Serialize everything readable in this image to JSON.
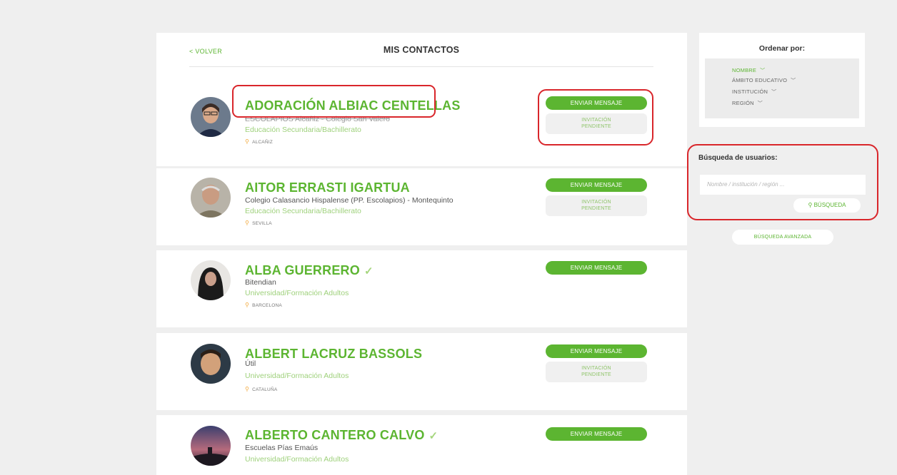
{
  "header": {
    "back_label": "< VOLVER",
    "title": "MIS CONTACTOS"
  },
  "contacts": [
    {
      "name": "ADORACIÓN ALBIAC CENTELLAS",
      "institution": "ESCOLAPIOS Alcañiz - Colegio San Valero",
      "level": "Educación Secundaria/Bachillerato",
      "location": "ALCAÑIZ",
      "message_label": "ENVIAR MENSAJE",
      "pending_label_1": "INVITACIÓN",
      "pending_label_2": "PENDIENTE"
    },
    {
      "name": "AITOR ERRASTI IGARTUA",
      "institution": "Colegio Calasancio Hispalense (PP. Escolapios) - Montequinto",
      "level": "Educación Secundaria/Bachillerato",
      "location": "SEVILLA",
      "message_label": "ENVIAR MENSAJE",
      "pending_label_1": "INVITACIÓN",
      "pending_label_2": "PENDIENTE"
    },
    {
      "name": "ALBA GUERRERO",
      "check": "✓",
      "institution": "Bitendian",
      "level": "Universidad/Formación Adultos",
      "location": "BARCELONA",
      "message_label": "ENVIAR MENSAJE"
    },
    {
      "name": "ALBERT LACRUZ BASSOLS",
      "institution": "Útil",
      "level": "Universidad/Formación Adultos",
      "location": "CATALUÑA",
      "message_label": "ENVIAR MENSAJE",
      "pending_label_1": "INVITACIÓN",
      "pending_label_2": "PENDIENTE"
    },
    {
      "name": "ALBERTO CANTERO CALVO",
      "check": "✓",
      "institution": "Escuelas Pías Emaús",
      "level": "Universidad/Formación Adultos",
      "message_label": "ENVIAR MENSAJE"
    }
  ],
  "sort": {
    "title": "Ordenar por:",
    "options": [
      "NOMBRE",
      "ÁMBITO EDUCATIVO",
      "INSTITUCIÓN",
      "REGIÓN"
    ],
    "active_color": "#5cb531"
  },
  "search": {
    "title": "Búsqueda de usuarios:",
    "placeholder": "Nombre / institución / región ...",
    "button_label": "BÚSQUEDA",
    "advanced_label": "BÚSQUEDA AVANZADA"
  },
  "colors": {
    "accent": "#5cb531",
    "highlight": "#d9262b",
    "location_pin": "#f2a83b"
  }
}
